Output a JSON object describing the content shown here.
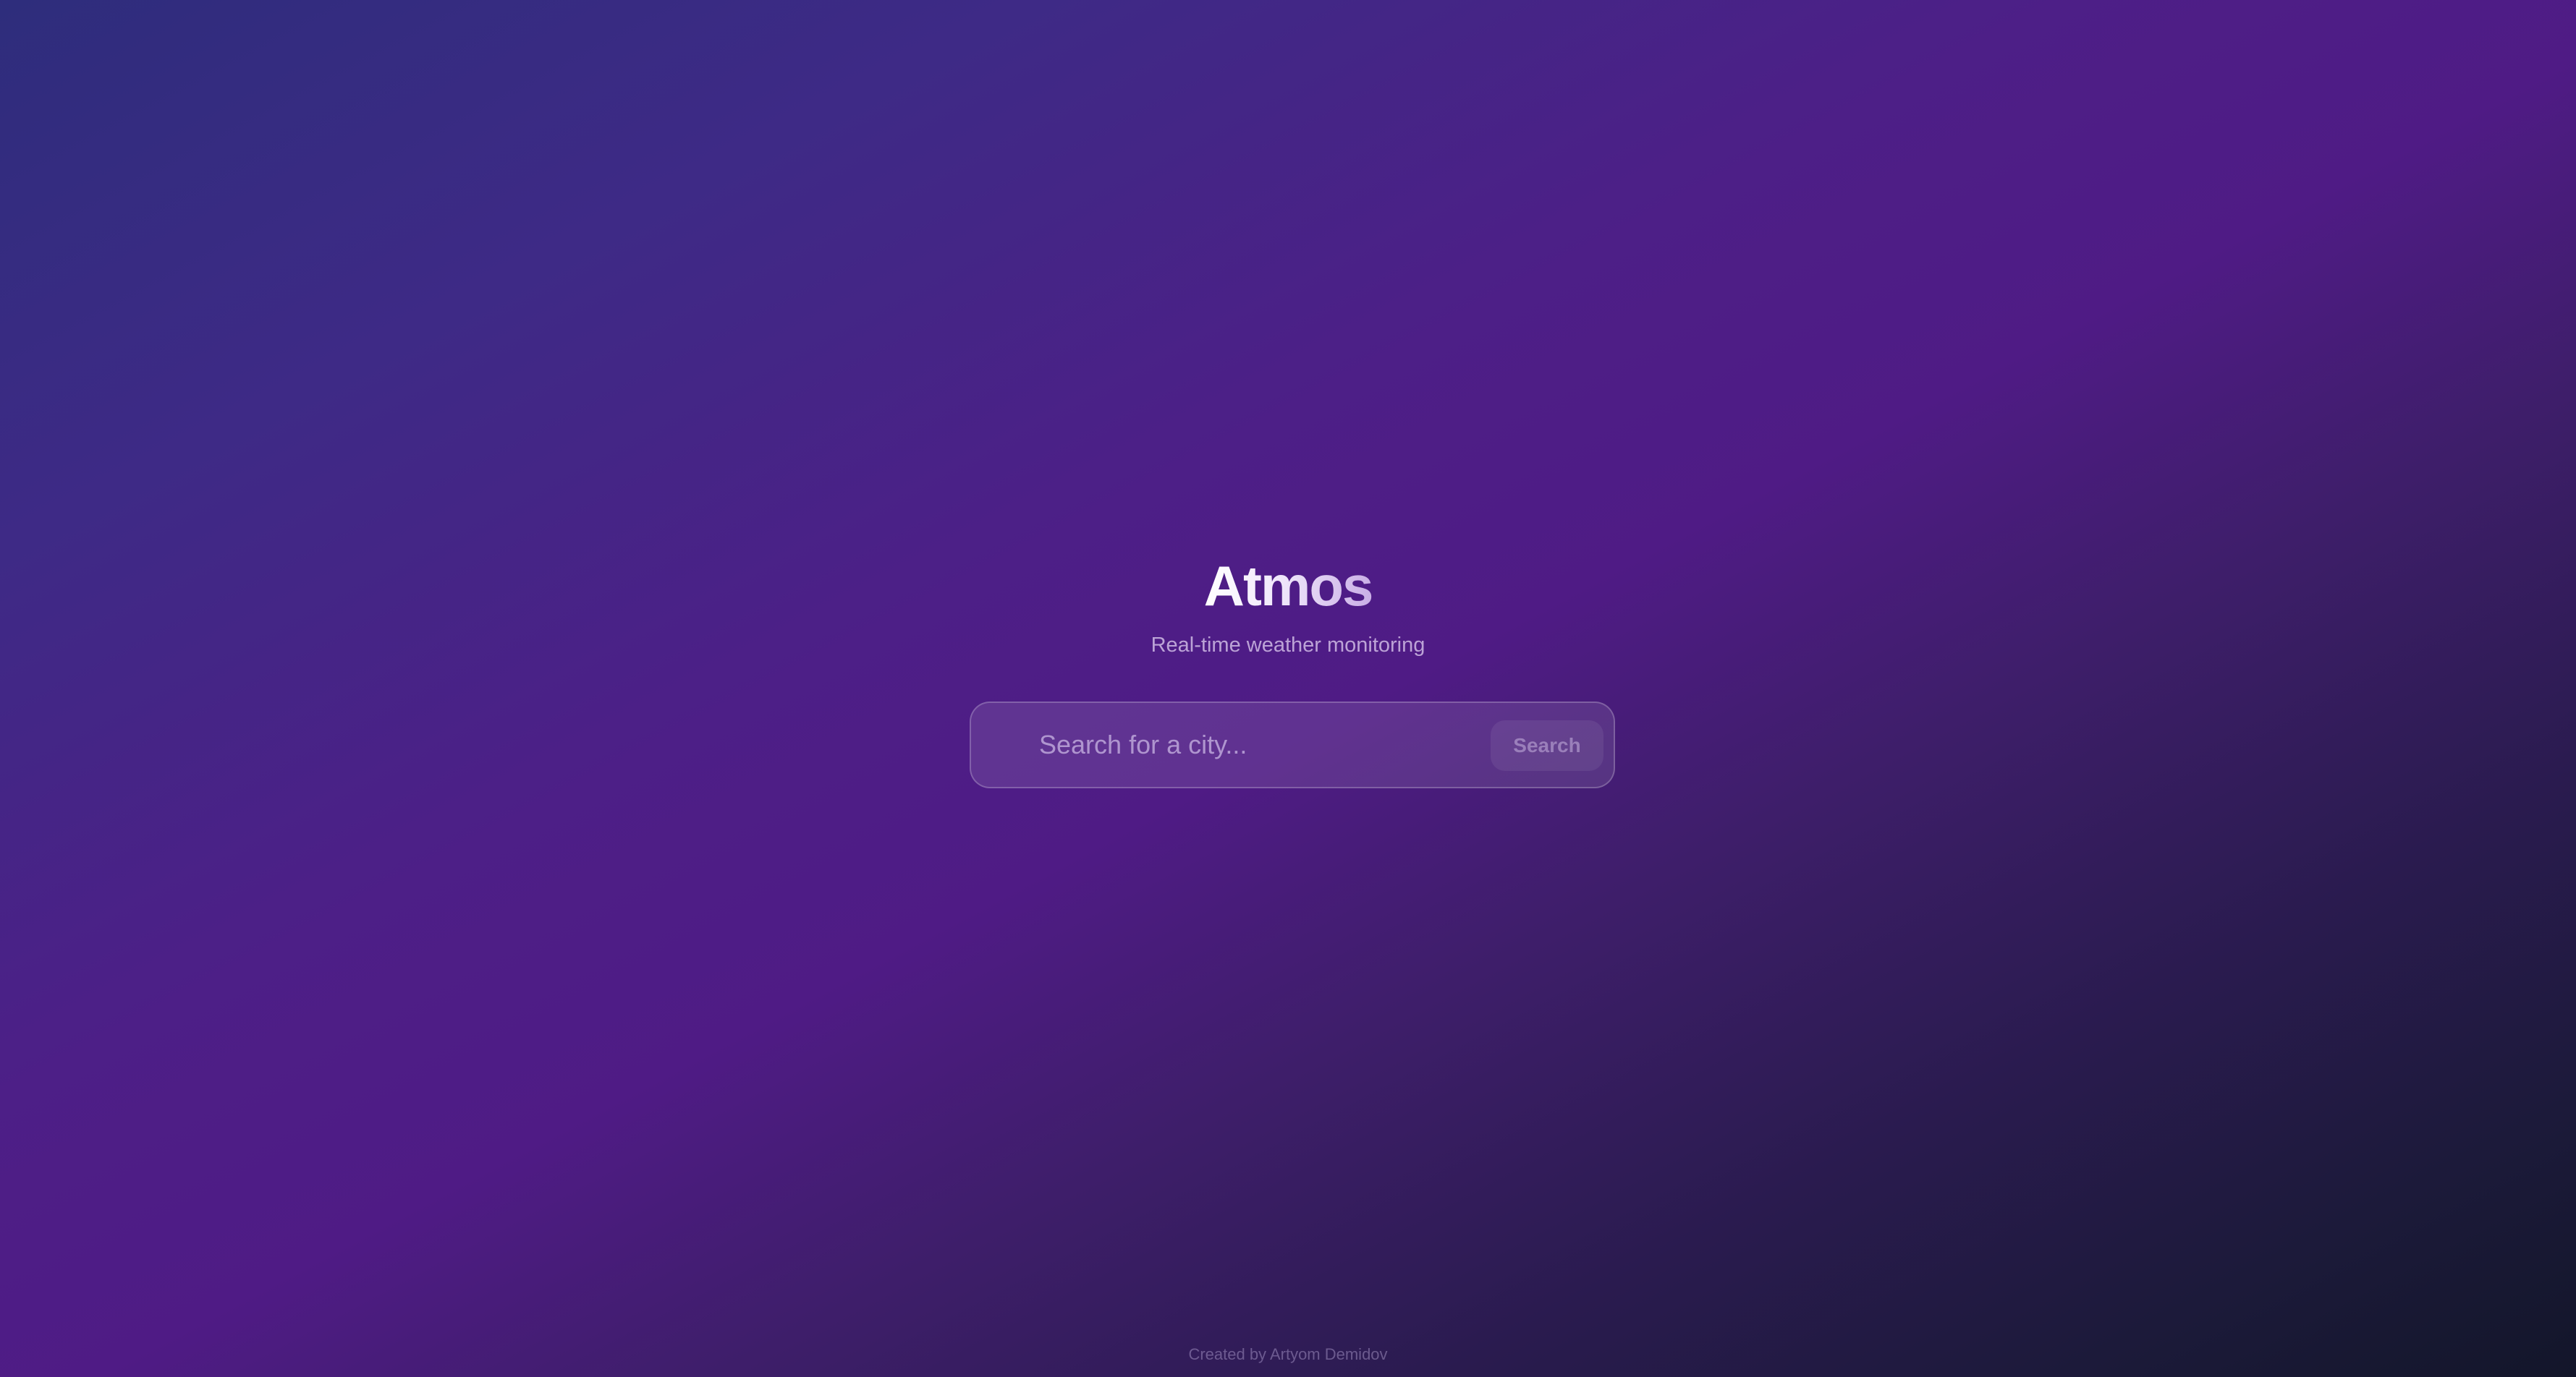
{
  "app": {
    "title": "Atmos",
    "subtitle": "Real-time weather monitoring"
  },
  "search": {
    "placeholder": "Search for a city...",
    "value": "",
    "button_label": "Search",
    "icon": "search-icon"
  },
  "footer": {
    "text": "Created by Artyom Demidov"
  },
  "colors": {
    "background_start": "#2e2d7c",
    "background_mid": "#4f1b85",
    "background_end": "#13162a"
  }
}
